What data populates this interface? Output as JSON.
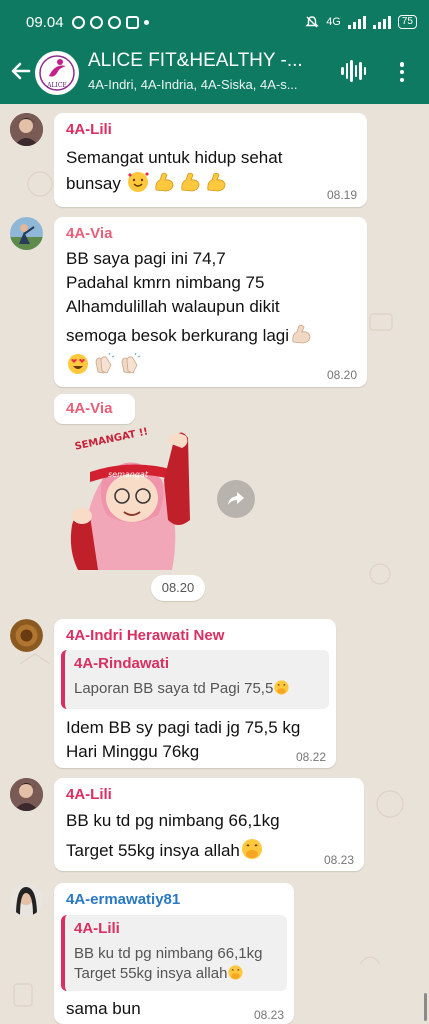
{
  "status_bar": {
    "time": "09.04",
    "network": "4G",
    "battery": "75"
  },
  "header": {
    "title": "ALICE FIT&HEALTHY -...",
    "subtitle": "4A-Indri, 4A-Indria, 4A-Siska, 4A-s...",
    "avatar_text": "ALICE"
  },
  "messages": [
    {
      "sender": "4A-Lili",
      "sender_color": "#d92f61",
      "lines": [
        "Semangat  untuk  hidup sehat",
        "bunsay"
      ],
      "time": "08.19"
    },
    {
      "sender": "4A-Via",
      "sender_color": "#e6607a",
      "lines": [
        "BB saya pagi ini 74,7",
        "Padahal kmrn nimbang 75",
        "Alhamdulillah walaupun dikit",
        "semoga besok berkurang  lagi"
      ],
      "time": "08.20"
    },
    {
      "sender": "4A-Via",
      "sender_color": "#e6607a",
      "sticker_text": "semangat",
      "sticker_banner": "SEMANGAT !!",
      "time": "08.20"
    },
    {
      "sender": "4A-Indri Herawati New",
      "sender_color": "#d92f61",
      "quote_name": "4A-Rindawati",
      "quote_lines": [
        "Laporan BB saya td Pagi 75,5"
      ],
      "lines": [
        "Idem BB sy pagi tadi jg 75,5 kg",
        "Hari Minggu 76kg"
      ],
      "time": "08.22"
    },
    {
      "sender": "4A-Lili",
      "sender_color": "#d92f61",
      "lines": [
        "BB ku td pg nimbang 66,1kg",
        "Target 55kg insya allah"
      ],
      "time": "08.23"
    },
    {
      "sender": "4A-ermawatiy81",
      "sender_color": "#2a78c4",
      "quote_name": "4A-Lili",
      "quote_lines": [
        "BB ku td pg nimbang 66,1kg",
        "Target 55kg insya allah"
      ],
      "lines": [
        "sama bun"
      ],
      "time": "08.23"
    }
  ],
  "colors": {
    "header_bg": "#0e7a61",
    "chat_bg": "#e9e2d8",
    "bubble_bg": "#ffffff"
  },
  "icons": [
    "back-arrow-icon",
    "voice-wave-icon",
    "more-vert-icon",
    "forward-icon",
    "smiling-hearts-emoji",
    "flexed-biceps-emoji",
    "heart-eyes-emoji",
    "clapping-hands-emoji",
    "face-hand-over-mouth-emoji"
  ]
}
